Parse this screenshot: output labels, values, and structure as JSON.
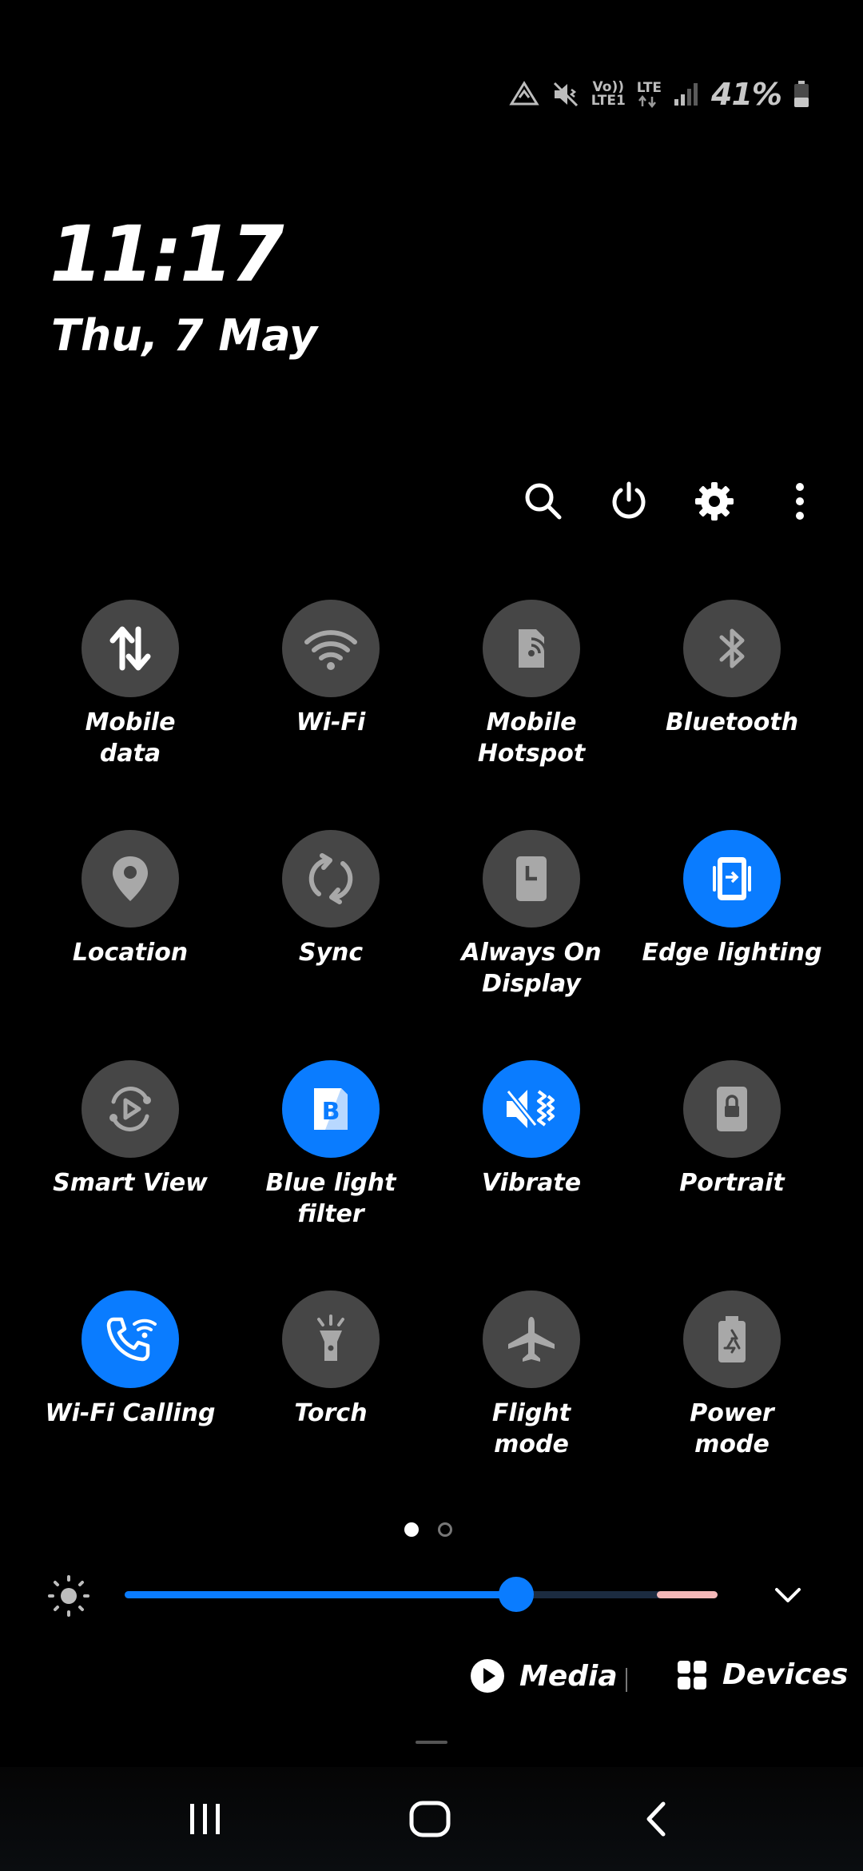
{
  "status": {
    "volte_top": "Vo))",
    "volte_bottom": "LTE1",
    "lte_label": "LTE",
    "battery_percent": "41%",
    "battery_level": 0.41
  },
  "clock": {
    "time": "11:17",
    "date": "Thu, 7 May"
  },
  "actions": [
    "search-icon",
    "power-icon",
    "gear-icon",
    "more-vertical-icon"
  ],
  "tiles": [
    {
      "label": "Mobile\ndata",
      "icon": "mobile-data-icon",
      "on": true
    },
    {
      "label": "Wi-Fi",
      "icon": "wifi-icon",
      "on": false
    },
    {
      "label": "Mobile\nHotspot",
      "icon": "hotspot-icon",
      "on": false
    },
    {
      "label": "Bluetooth",
      "icon": "bluetooth-icon",
      "on": false
    },
    {
      "label": "Location",
      "icon": "location-icon",
      "on": false
    },
    {
      "label": "Sync",
      "icon": "sync-icon",
      "on": false
    },
    {
      "label": "Always On\nDisplay",
      "icon": "always-on-display-icon",
      "on": false
    },
    {
      "label": "Edge lighting",
      "icon": "edge-lighting-icon",
      "on": true
    },
    {
      "label": "Smart View",
      "icon": "smart-view-icon",
      "on": false
    },
    {
      "label": "Blue light\nfilter",
      "icon": "blue-light-filter-icon",
      "on": true
    },
    {
      "label": "Vibrate",
      "icon": "vibrate-icon",
      "on": true
    },
    {
      "label": "Portrait",
      "icon": "portrait-lock-icon",
      "on": false
    },
    {
      "label": "Wi-Fi Calling",
      "icon": "wifi-calling-icon",
      "on": true
    },
    {
      "label": "Torch",
      "icon": "torch-icon",
      "on": false
    },
    {
      "label": "Flight\nmode",
      "icon": "airplane-icon",
      "on": false
    },
    {
      "label": "Power\nmode",
      "icon": "power-mode-icon",
      "on": false
    }
  ],
  "page_indicator": {
    "count": 2,
    "active": 0
  },
  "brightness": {
    "level": 0.66
  },
  "media": {
    "label": "Media"
  },
  "devices": {
    "label": "Devices"
  },
  "colors": {
    "accent": "#0a7cff",
    "tile_off": "#464646",
    "background": "#000000"
  }
}
